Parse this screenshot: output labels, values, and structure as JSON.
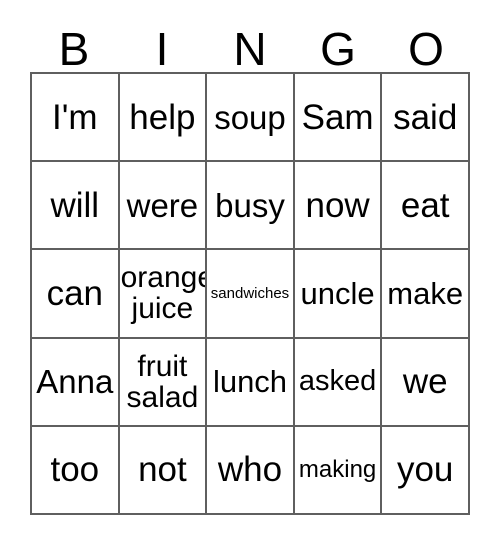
{
  "card": {
    "header_letters": [
      "B",
      "I",
      "N",
      "G",
      "O"
    ],
    "rows": [
      [
        {
          "text": "I'm",
          "size": "fs-xl"
        },
        {
          "text": "help",
          "size": "fs-xl"
        },
        {
          "text": "soup",
          "size": "fs-lg"
        },
        {
          "text": "Sam",
          "size": "fs-xl"
        },
        {
          "text": "said",
          "size": "fs-xl"
        }
      ],
      [
        {
          "text": "will",
          "size": "fs-xl"
        },
        {
          "text": "were",
          "size": "fs-lg"
        },
        {
          "text": "busy",
          "size": "fs-lg"
        },
        {
          "text": "now",
          "size": "fs-xl"
        },
        {
          "text": "eat",
          "size": "fs-xl"
        }
      ],
      [
        {
          "text": "can",
          "size": "fs-xl"
        },
        {
          "text": "orange\njuice",
          "size": "fs-wrap"
        },
        {
          "text": "sandwiches",
          "size": "fs-xxs"
        },
        {
          "text": "uncle",
          "size": "fs-md"
        },
        {
          "text": "make",
          "size": "fs-md"
        }
      ],
      [
        {
          "text": "Anna",
          "size": "fs-lg"
        },
        {
          "text": "fruit\nsalad",
          "size": "fs-wrap"
        },
        {
          "text": "lunch",
          "size": "fs-md"
        },
        {
          "text": "asked",
          "size": "fs-sm"
        },
        {
          "text": "we",
          "size": "fs-xl"
        }
      ],
      [
        {
          "text": "too",
          "size": "fs-xl"
        },
        {
          "text": "not",
          "size": "fs-xl"
        },
        {
          "text": "who",
          "size": "fs-xl"
        },
        {
          "text": "making",
          "size": "fs-xs"
        },
        {
          "text": "you",
          "size": "fs-xl"
        }
      ]
    ]
  },
  "colors": {
    "border": "#5f5f5f",
    "background": "#ffffff",
    "text": "#000000"
  }
}
